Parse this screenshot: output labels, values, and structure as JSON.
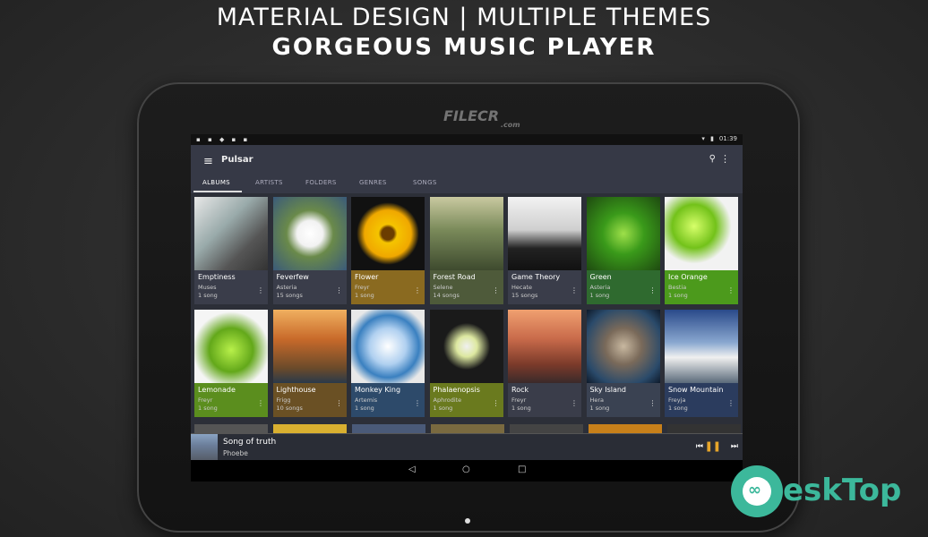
{
  "headline": {
    "line1": "MATERIAL DESIGN | MULTIPLE THEMES",
    "line2": "GORGEOUS MUSIC PLAYER"
  },
  "statusbar": {
    "time": "01:39"
  },
  "app": {
    "title": "Pulsar"
  },
  "tabs": [
    "ALBUMS",
    "ARTISTS",
    "FOLDERS",
    "GENRES",
    "SONGS"
  ],
  "albums": [
    {
      "title": "Emptiness",
      "artist": "Muses",
      "count": "1 song",
      "color": "#3a3d4a"
    },
    {
      "title": "Feverfew",
      "artist": "Asteria",
      "count": "15 songs",
      "color": "#3a3d4a"
    },
    {
      "title": "Flower",
      "artist": "Freyr",
      "count": "1 song",
      "color": "#8a6a20"
    },
    {
      "title": "Forest Road",
      "artist": "Selene",
      "count": "14 songs",
      "color": "#4e5a3a"
    },
    {
      "title": "Game Theory",
      "artist": "Hecate",
      "count": "15 songs",
      "color": "#3a3d4a"
    },
    {
      "title": "Green",
      "artist": "Asteria",
      "count": "1 song",
      "color": "#2f6a2f"
    },
    {
      "title": "Ice Orange",
      "artist": "Bestia",
      "count": "1 song",
      "color": "#4c9a1c"
    },
    {
      "title": "Lemonade",
      "artist": "Freyr",
      "count": "1 song",
      "color": "#5b8e1e"
    },
    {
      "title": "Lighthouse",
      "artist": "Frigg",
      "count": "10 songs",
      "color": "#6a5024"
    },
    {
      "title": "Monkey King",
      "artist": "Artemis",
      "count": "1 song",
      "color": "#2d4a6a"
    },
    {
      "title": "Phalaenopsis",
      "artist": "Aphrodite",
      "count": "1 song",
      "color": "#6a7a1e"
    },
    {
      "title": "Rock",
      "artist": "Freyr",
      "count": "1 song",
      "color": "#3a3d4a"
    },
    {
      "title": "Sky Island",
      "artist": "Hera",
      "count": "1 song",
      "color": "#3a4252"
    },
    {
      "title": "Snow Mountain",
      "artist": "Freyja",
      "count": "1 song",
      "color": "#2b3c5e"
    }
  ],
  "nowplaying": {
    "title": "Song of truth",
    "artist": "Phoebe"
  },
  "watermark": {
    "text": "FILECR",
    "sub": ".com"
  },
  "brand": {
    "text": "eskTop"
  }
}
